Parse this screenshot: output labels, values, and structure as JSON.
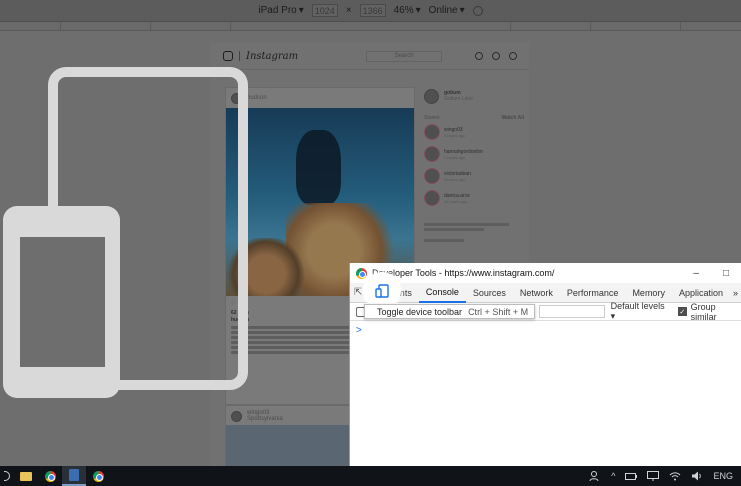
{
  "emulation": {
    "device": "iPad Pro",
    "width": "1024",
    "times": "×",
    "height": "1366",
    "zoom": "46%",
    "throttle": "Online"
  },
  "instagram": {
    "logo": "Instagram",
    "search_placeholder": "Search",
    "post1": {
      "user": "hudson",
      "likes": "62 likes",
      "caption_user": "hudson"
    },
    "post2": {
      "user": "wingo03",
      "location": "Spottsylvania"
    },
    "sidebar": {
      "me_name": "gobum",
      "me_sub": "Gobum Lane",
      "stories_label": "Stories",
      "watch_all": "Watch All",
      "stories": [
        {
          "name": "wingo03",
          "sub": "5 hours ago"
        },
        {
          "name": "hannahgordonlim",
          "sub": "7 hours ago"
        },
        {
          "name": "victoriadean",
          "sub": "9 hours ago"
        },
        {
          "name": "danica.arce",
          "sub": "10 hours ago"
        }
      ]
    }
  },
  "devtools": {
    "title": "Developer Tools - https://www.instagram.com/",
    "minimize": "–",
    "maximize": "□",
    "tabs": [
      "Elements",
      "Console",
      "Sources",
      "Network",
      "Performance",
      "Memory",
      "Application"
    ],
    "more_tabs": "»",
    "active_tab": "Console",
    "tooltip": {
      "label": "Toggle device toolbar",
      "shortcut": "Ctrl + Shift + M"
    },
    "console": {
      "levels": "Default levels",
      "group_similar": "Group similar",
      "prompt": ">"
    }
  },
  "taskbar": {
    "language": "ENG"
  },
  "colors": {
    "accent": "#1a73e8",
    "overlay": "#6e6e6e",
    "illustration": "#d6d6d6"
  }
}
